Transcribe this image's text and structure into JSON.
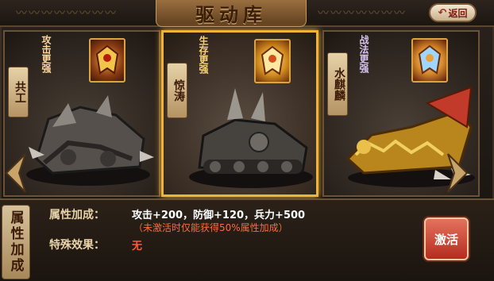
{
  "header": {
    "title": "驱动库",
    "back_label": "返回"
  },
  "cards": [
    {
      "name": "共工",
      "buff": "攻击更强",
      "selected": false
    },
    {
      "name": "惊涛",
      "buff": "生存更强",
      "selected": true
    },
    {
      "name": "水麒麟",
      "buff": "战法更强",
      "selected": false
    }
  ],
  "bottom": {
    "tab_label": "属性加成",
    "attr_label": "属性加成：",
    "attr_value": "攻击+200，防御+120，兵力+500",
    "attr_note": "（未激活时仅能获得50%属性加成）",
    "special_label": "特殊效果：",
    "special_value": "无",
    "activate_label": "激活"
  },
  "icons": {
    "left_arrow": "chevron-left-icon",
    "right_arrow": "chevron-right-icon",
    "back": "back-arrow-icon"
  },
  "colors": {
    "selected_border": "#f0b33a",
    "activate_button": "#c83a28",
    "attr_value": "#ffffff",
    "note_text": "#ff6a3a"
  }
}
